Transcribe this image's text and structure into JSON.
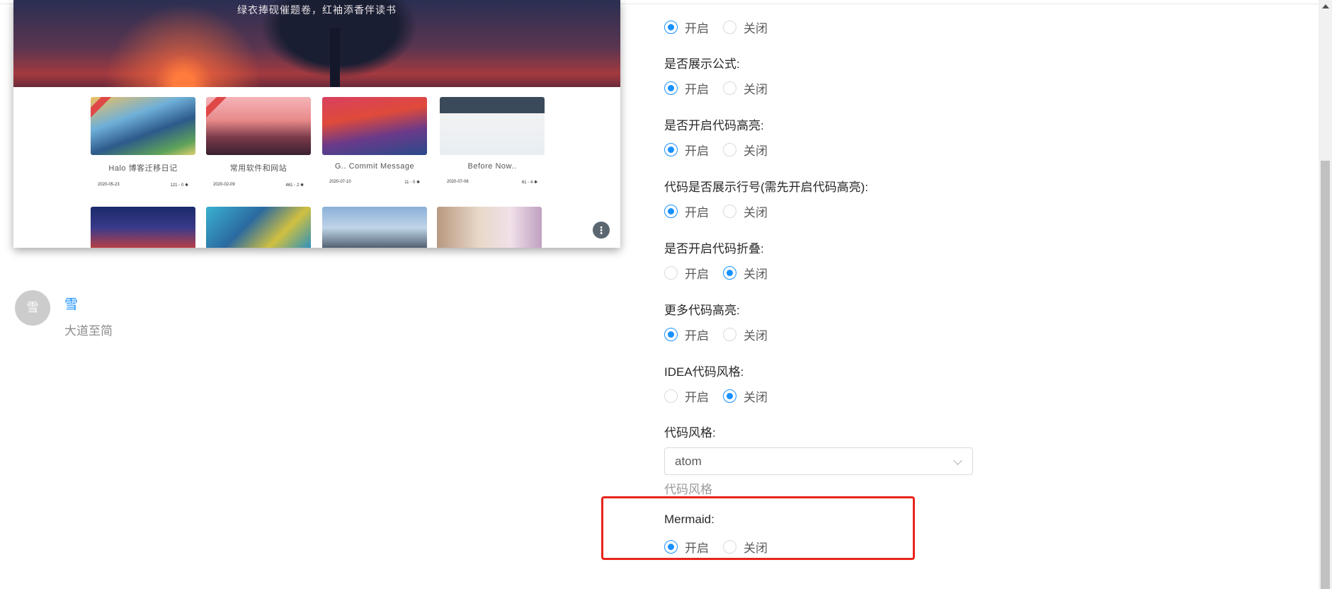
{
  "preview": {
    "banner_text": "绿衣捧砚催题卷，红袖添香伴读书",
    "cards": [
      {
        "title": "Halo 博客迁移日记",
        "date": "2020-05-23",
        "stats": "121 ◦ 0 ✱"
      },
      {
        "title": "常用软件和网站",
        "date": "2020-02-09",
        "stats": "461 ◦ 2 ✱"
      },
      {
        "title": "G.. Commit Message",
        "date": "2020-07-10",
        "stats": "11 ◦ 0 ✱"
      },
      {
        "title": "Before Now..",
        "date": "2020-07-06",
        "stats": "61 ◦ 4 ✱"
      }
    ],
    "more_icon": "⋮"
  },
  "comment": {
    "avatar_text": "雪",
    "name": "雪",
    "subtitle": "大道至简"
  },
  "form": {
    "on_label": "开启",
    "off_label": "关闭",
    "items": [
      {
        "label": "",
        "value": "on"
      },
      {
        "label": "是否展示公式:",
        "value": "on"
      },
      {
        "label": "是否开启代码高亮:",
        "value": "on"
      },
      {
        "label": "代码是否展示行号(需先开启代码高亮):",
        "value": "on"
      },
      {
        "label": "是否开启代码折叠:",
        "value": "off"
      },
      {
        "label": "更多代码高亮:",
        "value": "on"
      },
      {
        "label": "IDEA代码风格:",
        "value": "off"
      }
    ],
    "code_style": {
      "label": "代码风格:",
      "value": "atom",
      "help": "代码风格"
    },
    "mermaid": {
      "label": "Mermaid:",
      "value": "on"
    }
  },
  "colors": {
    "primary": "#1890ff",
    "highlight": "#e8241c"
  }
}
